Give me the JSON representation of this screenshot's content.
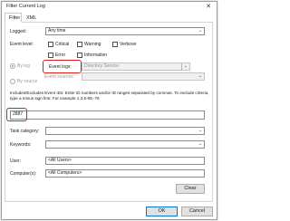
{
  "window": {
    "title": "Filter Current Log",
    "close_glyph": "✕"
  },
  "tabs": [
    {
      "label": "Filter"
    },
    {
      "label": "XML"
    }
  ],
  "logged": {
    "label": "Logged:",
    "value": "Any time"
  },
  "event_level": {
    "label": "Event level:",
    "checkboxes": [
      {
        "label": "Critical",
        "checked": false
      },
      {
        "label": "Warning",
        "checked": false
      },
      {
        "label": "Verbose",
        "checked": false
      },
      {
        "label": "Error",
        "checked": false
      },
      {
        "label": "Information",
        "checked": false
      }
    ]
  },
  "by_log": {
    "label": "By log",
    "selected": true
  },
  "by_source": {
    "label": "By source",
    "selected": false
  },
  "event_logs": {
    "label": "Event logs:",
    "value": "Directory Service"
  },
  "event_sources": {
    "label": "Event sources:",
    "value": ""
  },
  "help_text": "Includes/Excludes Event IDs: Enter ID numbers and/or ID ranges separated by commas. To exclude criteria, type a minus sign first. For example 1,3,5-99,-76",
  "event_ids": {
    "value": "2887"
  },
  "task_category": {
    "label": "Task category:",
    "value": ""
  },
  "keywords": {
    "label": "Keywords:",
    "value": ""
  },
  "user": {
    "label": "User:",
    "value": "<All Users>"
  },
  "computers": {
    "label": "Computer(s):",
    "value": "<All Computers>"
  },
  "buttons": {
    "clear": "Clear",
    "ok": "OK",
    "cancel": "Cancel"
  },
  "colors": {
    "highlight": "#e21b1b",
    "accent": "#0078d7"
  }
}
